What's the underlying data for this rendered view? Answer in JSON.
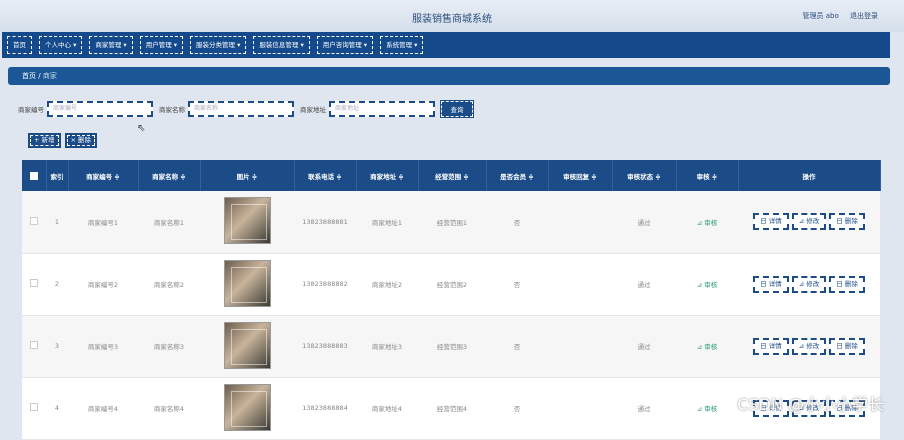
{
  "header": {
    "title": "服装销售商城系统",
    "user": "管理员 abo",
    "logout": "退出登录"
  },
  "nav": [
    "首页",
    "个人中心 ▾",
    "商家管理 ▾",
    "用户管理 ▾",
    "服装分类管理 ▾",
    "服装信息管理 ▾",
    "用户咨询管理 ▾",
    "系统管理 ▾"
  ],
  "breadcrumb": {
    "home": "首页",
    "sep": "/",
    "current": "商家"
  },
  "search": {
    "f1_label": "商家编号",
    "f1_ph": "商家编号",
    "f2_label": "商家名称",
    "f2_ph": "商家名称",
    "f3_label": "商家地址",
    "f3_ph": "商家地址",
    "btn": "查询"
  },
  "toolbar": {
    "add": "+ 新增",
    "delete": "× 删除"
  },
  "table": {
    "headers": [
      "索引",
      "商家编号 ≑",
      "商家名称 ≑",
      "图片 ≑",
      "联系电话 ≑",
      "商家地址 ≑",
      "经营范围 ≑",
      "是否会员 ≑",
      "审核回复 ≑",
      "审核状态 ≑",
      "审核 ≑",
      "操作"
    ],
    "rows": [
      {
        "idx": "1",
        "code": "商家编号1",
        "name": "商家名称1",
        "phone": "13823888881",
        "addr": "商家地址1",
        "scope": "经营范围1",
        "member": "否",
        "reply": "",
        "status": "通过",
        "audit": "⊿ 审核"
      },
      {
        "idx": "2",
        "code": "商家编号2",
        "name": "商家名称2",
        "phone": "13823888882",
        "addr": "商家地址2",
        "scope": "经营范围2",
        "member": "否",
        "reply": "",
        "status": "通过",
        "audit": "⊿ 审核"
      },
      {
        "idx": "3",
        "code": "商家编号3",
        "name": "商家名称3",
        "phone": "13823888883",
        "addr": "商家地址3",
        "scope": "经营范围3",
        "member": "否",
        "reply": "",
        "status": "通过",
        "audit": "⊿ 审核"
      },
      {
        "idx": "4",
        "code": "商家编号4",
        "name": "商家名称4",
        "phone": "13823888884",
        "addr": "商家地址4",
        "scope": "经营范围4",
        "member": "否",
        "reply": "",
        "status": "通过",
        "audit": "⊿ 审核"
      }
    ],
    "ops": [
      "日 详情",
      "⊿ 修改",
      "日 删除"
    ]
  },
  "watermark": "CSDN @小小小学长"
}
